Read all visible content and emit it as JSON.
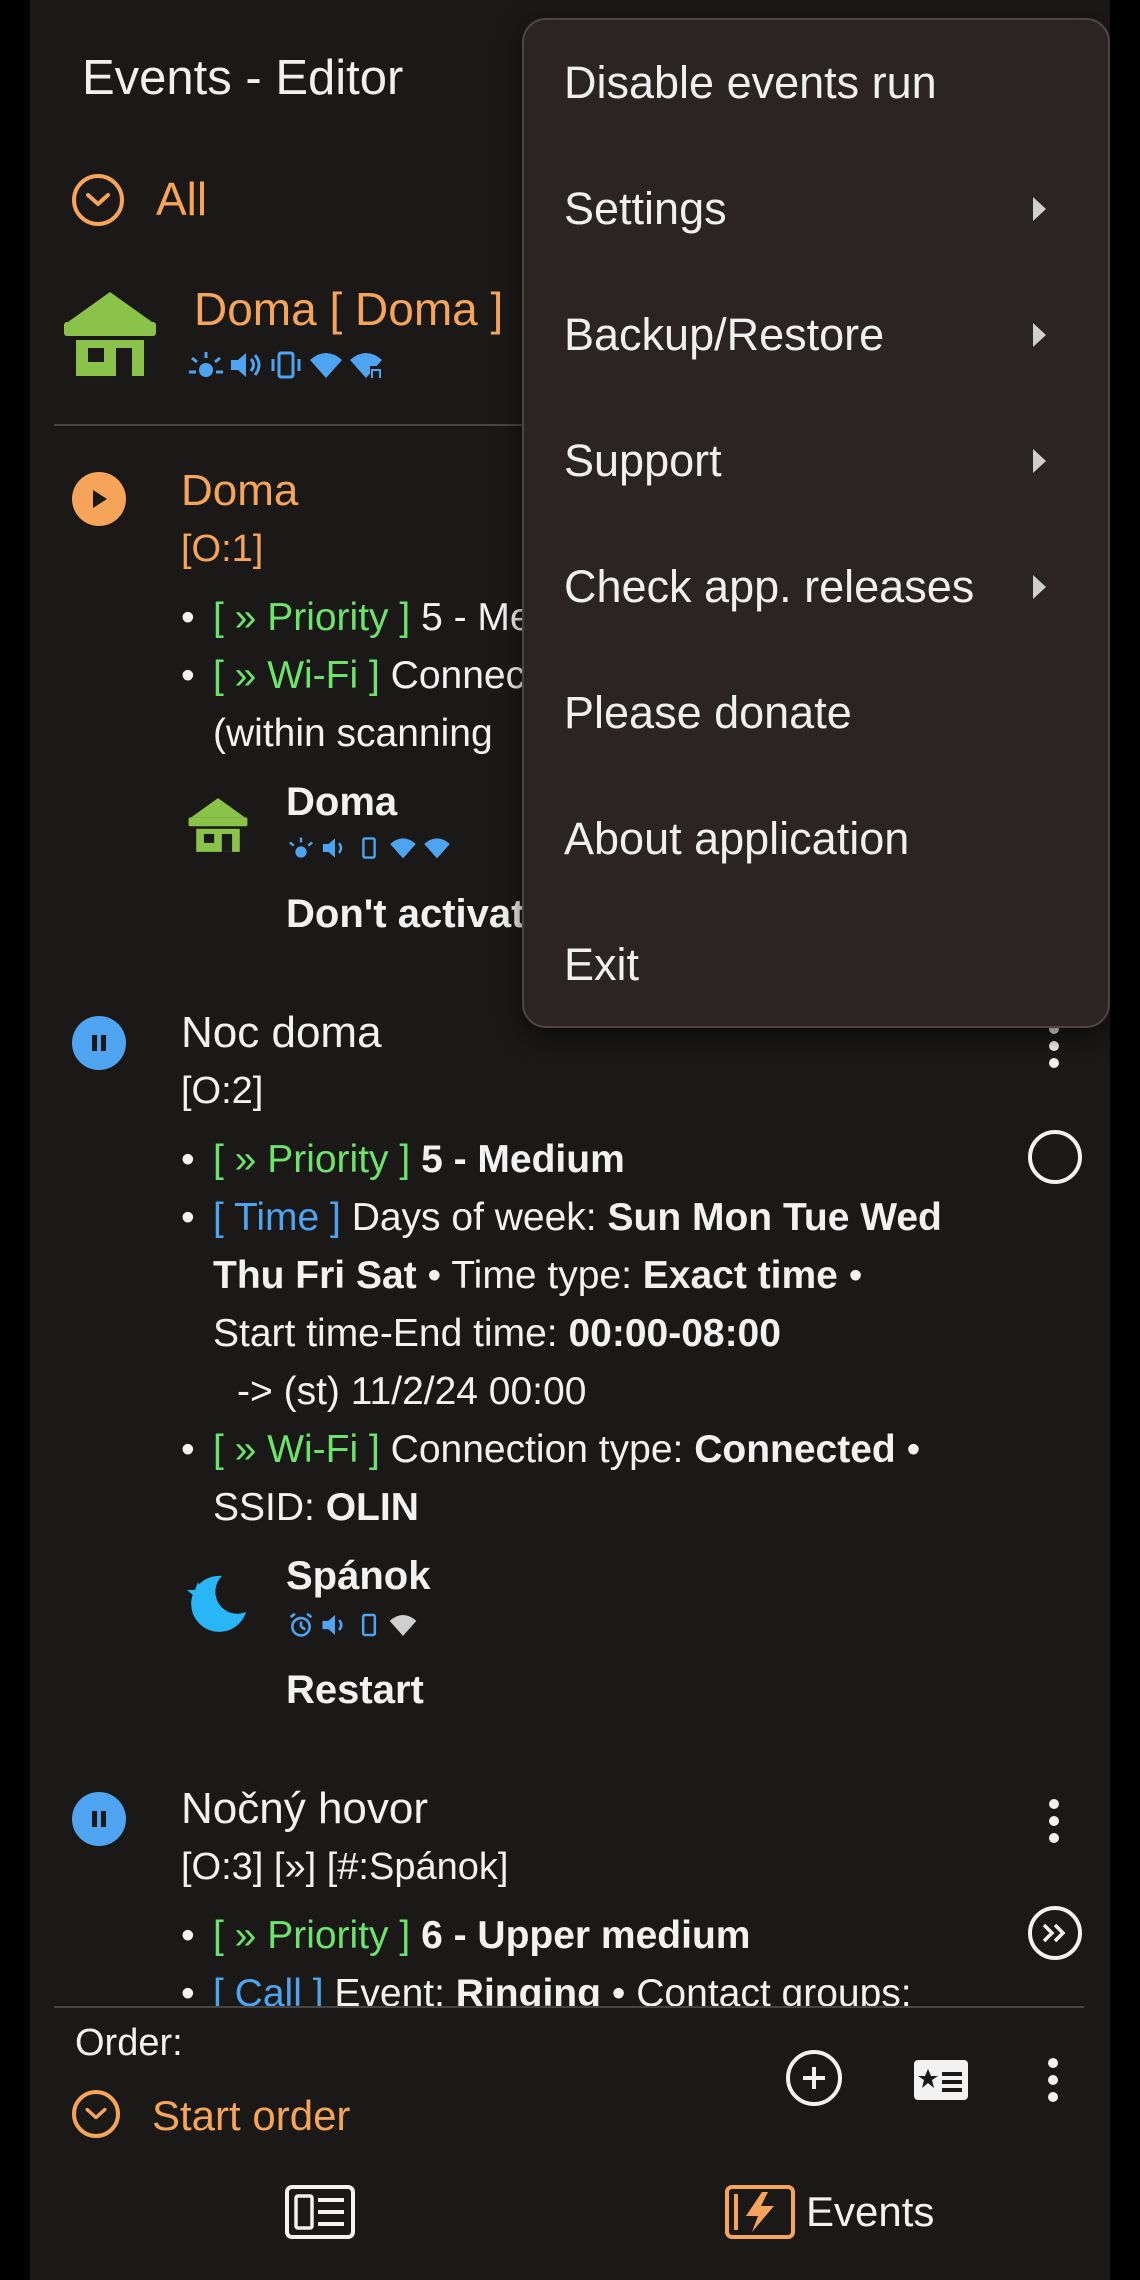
{
  "header": {
    "title": "Events - Editor"
  },
  "filter": {
    "label": "All"
  },
  "active_profile": {
    "name": "Doma [ Doma ]"
  },
  "events": [
    {
      "name": "Doma",
      "order": "[O:1]",
      "priority_tag": "[ » Priority ]",
      "priority_value": "5 - Me",
      "wifi_tag": "[ » Wi-Fi ]",
      "wifi_text": "Connec",
      "wifi_cont": "(within scanning",
      "profile_name": "Doma",
      "profile_action": "Don't activat"
    },
    {
      "name": "Noc doma",
      "order": "[O:2]",
      "priority_tag": "[ » Priority ]",
      "priority_value": "5 - Medium",
      "time_tag": "[ Time ]",
      "time_l1_a": "Days of week:",
      "time_l1_b": "Sun Mon Tue Wed",
      "time_l2_a": "Thu Fri Sat",
      "time_l2_b": "• Time type:",
      "time_l2_c": "Exact time",
      "time_l2_d": "•",
      "time_l3_a": "Start time-End time:",
      "time_l3_b": "00:00-08:00",
      "time_l4": "-> (st) 11/2/24 00:00",
      "wifi_tag": "[ » Wi-Fi ]",
      "wifi_l1_a": "Connection type:",
      "wifi_l1_b": "Connected",
      "wifi_l1_c": "•",
      "wifi_l2_a": "SSID:",
      "wifi_l2_b": "OLIN",
      "profile_name": "Spánok",
      "profile_action": "Restart"
    },
    {
      "name": "Nočný hovor",
      "order": "[O:3] [»] [#:Spánok]",
      "priority_tag": "[ » Priority ]",
      "priority_value": "6 - Upper medium",
      "call_tag": "[ Call ]",
      "call_a": "Event:",
      "call_b": "Ringing",
      "call_c": "• Contact groups:"
    }
  ],
  "bottom": {
    "order_label": "Order:",
    "order_value": "Start order",
    "nav_events": "Events"
  },
  "menu": {
    "items": [
      "Disable events run",
      "Settings",
      "Backup/Restore",
      "Support",
      "Check app. releases",
      "Please donate",
      "About application",
      "Exit"
    ]
  },
  "colors": {
    "accent": "#f6a45a",
    "green": "#6ee36b",
    "blue": "#4ea4f0",
    "background": "#1b1918",
    "menu": "#2a2522"
  }
}
